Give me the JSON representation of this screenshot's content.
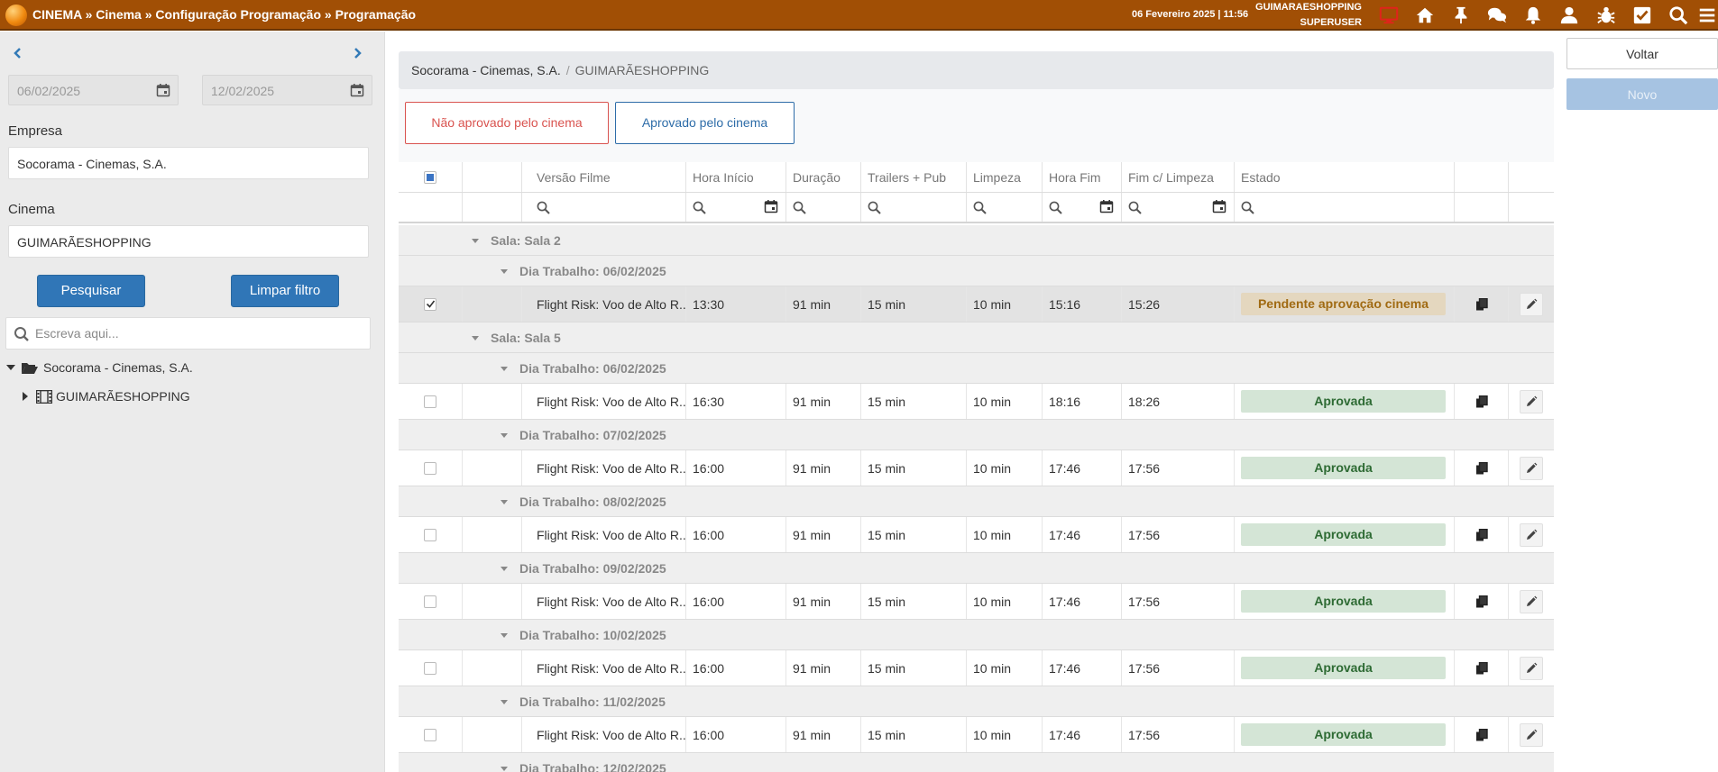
{
  "topbar": {
    "breadcrumb": "CINEMA » Cinema » Configuração Programação » Programação",
    "datetime": "06 Fevereiro 2025 | 11:56",
    "user_location": "GUIMARAESHOPPING",
    "user_role": "SUPERUSER",
    "icons": [
      "monitor-icon",
      "home-icon",
      "pin-icon",
      "chat-icon",
      "bell-icon",
      "user-icon",
      "bug-icon",
      "checkbox-icon",
      "search-icon",
      "menu-icon"
    ],
    "alert_color": "#e0241b"
  },
  "left": {
    "date_from": "06/02/2025",
    "date_to": "12/02/2025",
    "empresa_label": "Empresa",
    "empresa_value": "Socorama - Cinemas, S.A.",
    "cinema_label": "Cinema",
    "cinema_value": "GUIMARÃESHOPPING",
    "search_button": "Pesquisar",
    "clear_button": "Limpar filtro",
    "tree_search_placeholder": "Escreva aqui...",
    "tree": {
      "root": "Socorama - Cinemas, S.A.",
      "child": "GUIMARÃESHOPPING"
    }
  },
  "main": {
    "breadcrumb": {
      "company": "Socorama - Cinemas, S.A.",
      "cinema": "GUIMARÃESHOPPING"
    },
    "filters": {
      "not_approved": "Não aprovado pelo cinema",
      "approved": "Aprovado pelo cinema",
      "not_approved_color": "#d9534f",
      "approved_color": "#2d6ca8"
    },
    "columns": [
      "Versão Filme",
      "Hora Início",
      "Duração",
      "Trailers + Pub",
      "Limpeza",
      "Hora Fim",
      "Fim c/ Limpeza",
      "Estado"
    ],
    "groups": [
      {
        "sala": "Sala: Sala 2",
        "days": [
          {
            "label": "Dia Trabalho: 06/02/2025",
            "rows": [
              {
                "film": "Flight Risk: Voo de Alto R...",
                "start": "13:30",
                "duration": "91 min",
                "trailers": "15 min",
                "cleaning": "10 min",
                "end": "15:16",
                "end_clean": "15:26",
                "state": "Pendente aprovação cinema",
                "state_type": "pend",
                "checked": true
              }
            ]
          }
        ]
      },
      {
        "sala": "Sala: Sala 5",
        "days": [
          {
            "label": "Dia Trabalho: 06/02/2025",
            "rows": [
              {
                "film": "Flight Risk: Voo de Alto R...",
                "start": "16:30",
                "duration": "91 min",
                "trailers": "15 min",
                "cleaning": "10 min",
                "end": "18:16",
                "end_clean": "18:26",
                "state": "Aprovada",
                "state_type": "ok",
                "checked": false
              }
            ]
          },
          {
            "label": "Dia Trabalho: 07/02/2025",
            "rows": [
              {
                "film": "Flight Risk: Voo de Alto R...",
                "start": "16:00",
                "duration": "91 min",
                "trailers": "15 min",
                "cleaning": "10 min",
                "end": "17:46",
                "end_clean": "17:56",
                "state": "Aprovada",
                "state_type": "ok",
                "checked": false
              }
            ]
          },
          {
            "label": "Dia Trabalho: 08/02/2025",
            "rows": [
              {
                "film": "Flight Risk: Voo de Alto R...",
                "start": "16:00",
                "duration": "91 min",
                "trailers": "15 min",
                "cleaning": "10 min",
                "end": "17:46",
                "end_clean": "17:56",
                "state": "Aprovada",
                "state_type": "ok",
                "checked": false
              }
            ]
          },
          {
            "label": "Dia Trabalho: 09/02/2025",
            "rows": [
              {
                "film": "Flight Risk: Voo de Alto R...",
                "start": "16:00",
                "duration": "91 min",
                "trailers": "15 min",
                "cleaning": "10 min",
                "end": "17:46",
                "end_clean": "17:56",
                "state": "Aprovada",
                "state_type": "ok",
                "checked": false
              }
            ]
          },
          {
            "label": "Dia Trabalho: 10/02/2025",
            "rows": [
              {
                "film": "Flight Risk: Voo de Alto R...",
                "start": "16:00",
                "duration": "91 min",
                "trailers": "15 min",
                "cleaning": "10 min",
                "end": "17:46",
                "end_clean": "17:56",
                "state": "Aprovada",
                "state_type": "ok",
                "checked": false
              }
            ]
          },
          {
            "label": "Dia Trabalho: 11/02/2025",
            "rows": [
              {
                "film": "Flight Risk: Voo de Alto R...",
                "start": "16:00",
                "duration": "91 min",
                "trailers": "15 min",
                "cleaning": "10 min",
                "end": "17:46",
                "end_clean": "17:56",
                "state": "Aprovada",
                "state_type": "ok",
                "checked": false
              }
            ]
          },
          {
            "label": "Dia Trabalho: 12/02/2025",
            "rows": []
          }
        ]
      }
    ]
  },
  "right": {
    "back_button": "Voltar",
    "new_button": "Novo"
  }
}
